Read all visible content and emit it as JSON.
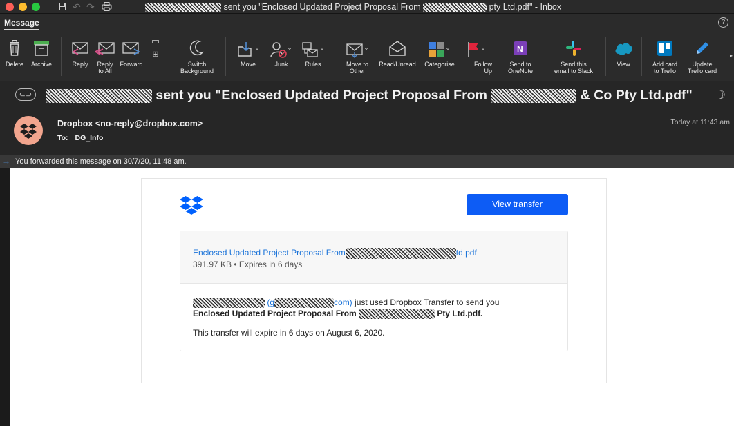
{
  "window": {
    "title_suffix": "sent you \"Enclosed Updated Project Proposal From",
    "title_tail": "pty Ltd.pdf\" - Inbox"
  },
  "ribbon": {
    "tab_label": "Message",
    "buttons": [
      {
        "label": "Delete",
        "icon": "trash-icon"
      },
      {
        "label": "Archive",
        "icon": "archive-icon"
      },
      {
        "label": "Reply",
        "icon": "reply-icon"
      },
      {
        "label": "Reply\nto All",
        "icon": "reply-all-icon"
      },
      {
        "label": "Forward",
        "icon": "forward-icon"
      },
      {
        "label": "Switch\nBackground",
        "icon": "moon-icon"
      },
      {
        "label": "Move",
        "icon": "move-icon"
      },
      {
        "label": "Junk",
        "icon": "junk-icon"
      },
      {
        "label": "Rules",
        "icon": "rules-icon"
      },
      {
        "label": "Move to\nOther",
        "icon": "move-other-icon"
      },
      {
        "label": "Read/Unread",
        "icon": "envelope-open-icon"
      },
      {
        "label": "Categorise",
        "icon": "categorise-icon"
      },
      {
        "label": "Follow\nUp",
        "icon": "flag-icon"
      },
      {
        "label": "Send to\nOneNote",
        "icon": "onenote-icon"
      },
      {
        "label": "Send this\nemail to Slack",
        "icon": "slack-icon"
      },
      {
        "label": "View",
        "icon": "salesforce-icon"
      },
      {
        "label": "Add card\nto Trello",
        "icon": "trello-icon"
      },
      {
        "label": "Update\nTrello card",
        "icon": "pencil-icon"
      }
    ]
  },
  "message": {
    "subject_middle": "sent you \"Enclosed Updated Project Proposal From",
    "subject_end": "& Co Pty Ltd.pdf\"",
    "sender": "Dropbox <no-reply@dropbox.com>",
    "to_label": "To:",
    "to_value": "DG_Info",
    "time": "Today at 11:43 am",
    "forward_notice": "You forwarded this message on 30/7/20, 11:48 am."
  },
  "email": {
    "button_label": "View transfer",
    "file_name_start": "Enclosed Updated Project Proposal From",
    "file_name_end": "td.pdf",
    "file_meta": "391.97 KB • Expires in 6 days",
    "line1_paren_open": "(g",
    "line1_email_end": "com)",
    "line1_rest": "just used Dropbox Transfer to send you",
    "line2_start": "Enclosed Updated Project Proposal From",
    "line2_end": "Pty Ltd.pdf.",
    "line3": "This transfer will expire in 6 days on August 6, 2020."
  },
  "colors": {
    "accent": "#0d5cf5",
    "link": "#1a73d9",
    "avatar_bg": "#f2a58e",
    "dropbox_blue": "#0061fe"
  }
}
